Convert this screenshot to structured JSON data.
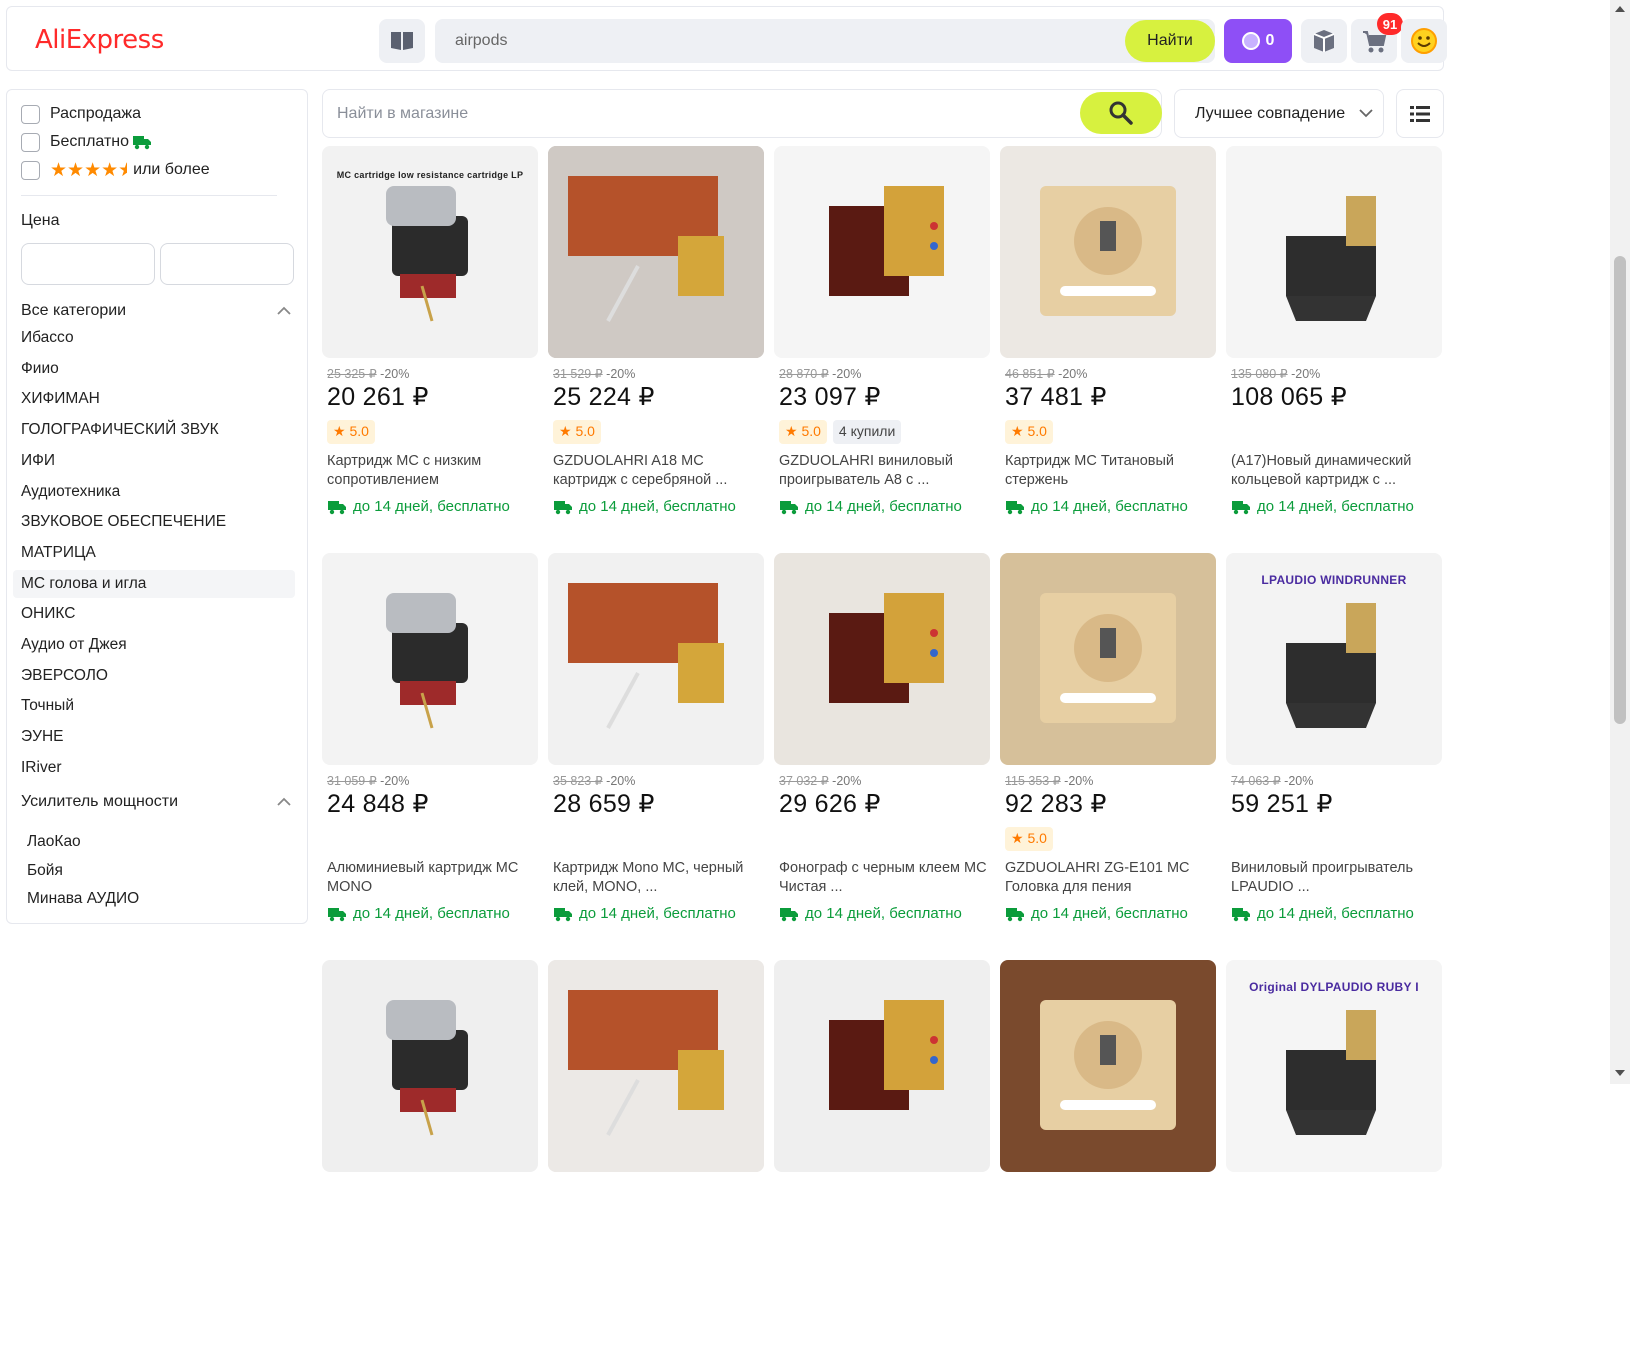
{
  "header": {
    "logo": "AliExpress",
    "search_value": "airpods",
    "find_label": "Найти",
    "coins_count": "0",
    "cart_badge": "91"
  },
  "filters": {
    "sale_label": "Распродажа",
    "free_label": "Бесплатно",
    "rating_label": "или более",
    "rating_stars": 4.5,
    "price_title": "Цена"
  },
  "categories": {
    "all_label": "Все категории",
    "items": [
      "Ибассо",
      "Фиио",
      "ХИФИМАН",
      "ГОЛОГРАФИЧЕСКИЙ ЗВУК",
      "ИФИ",
      "Аудиотехника",
      "ЗВУКОВОЕ ОБЕСПЕЧЕНИЕ",
      "МАТРИЦА",
      "МС голова и игла",
      "ОНИКС",
      "Аудио от Джея",
      "ЭВЕРСОЛО",
      "Точный",
      "ЭУНЕ",
      "IRiver"
    ],
    "selected_index": 8,
    "amp_label": "Усилитель мощности",
    "amp_items": [
      "ЛаоКао",
      "Бойя",
      "Минава АУДИО"
    ]
  },
  "store_search": {
    "placeholder": "Найти в магазине",
    "sort_label": "Лучшее совпадение"
  },
  "products": [
    {
      "old": "25 325 ₽",
      "disc": "-20%",
      "price": "20 261 ₽",
      "rating": "5.0",
      "bought": "",
      "title": "Картридж МС с низким сопротивлением",
      "ship": "до 14 дней, бесплатно",
      "img_caption": "MC cartridge low resistance cartridge LP"
    },
    {
      "old": "31 529 ₽",
      "disc": "-20%",
      "price": "25 224 ₽",
      "rating": "5.0",
      "bought": "",
      "title": "GZDUOLAHRI A18 MC картридж с серебряной ...",
      "ship": "до 14 дней, бесплатно",
      "img_caption": ""
    },
    {
      "old": "28 870 ₽",
      "disc": "-20%",
      "price": "23 097 ₽",
      "rating": "5.0",
      "bought": "4 купили",
      "title": "GZDUOLAHRI виниловый проигрыватель A8 с ...",
      "ship": "до 14 дней, бесплатно",
      "img_caption": ""
    },
    {
      "old": "46 851 ₽",
      "disc": "-20%",
      "price": "37 481 ₽",
      "rating": "5.0",
      "bought": "",
      "title": "Картридж МС Титановый стержень",
      "ship": "до 14 дней, бесплатно",
      "img_caption": ""
    },
    {
      "old": "135 080 ₽",
      "disc": "-20%",
      "price": "108 065 ₽",
      "rating": "",
      "bought": "",
      "title": "(A17)Новый динамический кольцевой картридж с ...",
      "ship": "до 14 дней, бесплатно",
      "img_caption": ""
    },
    {
      "old": "31 059 ₽",
      "disc": "-20%",
      "price": "24 848 ₽",
      "rating": "",
      "bought": "",
      "title": "Алюминиевый картридж MC MONO",
      "ship": "до 14 дней, бесплатно",
      "img_caption": ""
    },
    {
      "old": "35 823 ₽",
      "disc": "-20%",
      "price": "28 659 ₽",
      "rating": "",
      "bought": "",
      "title": "Картридж Mono MC, черный клей, MONO, ...",
      "ship": "до 14 дней, бесплатно",
      "img_caption": ""
    },
    {
      "old": "37 032 ₽",
      "disc": "-20%",
      "price": "29 626 ₽",
      "rating": "",
      "bought": "",
      "title": "Фонограф с черным клеем МС Чистая ...",
      "ship": "до 14 дней, бесплатно",
      "img_caption": ""
    },
    {
      "old": "115 353 ₽",
      "disc": "-20%",
      "price": "92 283 ₽",
      "rating": "5.0",
      "bought": "",
      "title": "GZDUOLAHRI ZG-E101 MC Головка для пения",
      "ship": "до 14 дней, бесплатно",
      "img_caption": ""
    },
    {
      "old": "74 063 ₽",
      "disc": "-20%",
      "price": "59 251 ₽",
      "rating": "",
      "bought": "",
      "title": "Виниловый проигрыватель LPAUDIO ...",
      "ship": "до 14 дней, бесплатно",
      "img_caption": "LPAUDIO WINDRUNNER"
    },
    {
      "old": "",
      "disc": "",
      "price": "",
      "rating": "",
      "bought": "",
      "title": "",
      "ship": "",
      "img_caption": ""
    },
    {
      "old": "",
      "disc": "",
      "price": "",
      "rating": "",
      "bought": "",
      "title": "",
      "ship": "",
      "img_caption": ""
    },
    {
      "old": "",
      "disc": "",
      "price": "",
      "rating": "",
      "bought": "",
      "title": "",
      "ship": "",
      "img_caption": ""
    },
    {
      "old": "",
      "disc": "",
      "price": "",
      "rating": "",
      "bought": "",
      "title": "",
      "ship": "",
      "img_caption": ""
    },
    {
      "old": "",
      "disc": "",
      "price": "",
      "rating": "",
      "bought": "",
      "title": "",
      "ship": "",
      "img_caption": "Original DYLPAUDIO RUBY I"
    }
  ],
  "colors": {
    "accent_red": "#ff2a2a",
    "lime": "#d7f13f",
    "purple": "#8e4ff6",
    "ship_green": "#0b9c3b",
    "star_orange": "#ff8a00"
  },
  "icons": [
    "catalog-icon",
    "search-icon",
    "coin-icon",
    "orders-icon",
    "cart-icon",
    "smiley-icon",
    "truck-icon",
    "star-icon",
    "chevron-up-icon",
    "chevron-down-icon",
    "list-view-icon"
  ]
}
